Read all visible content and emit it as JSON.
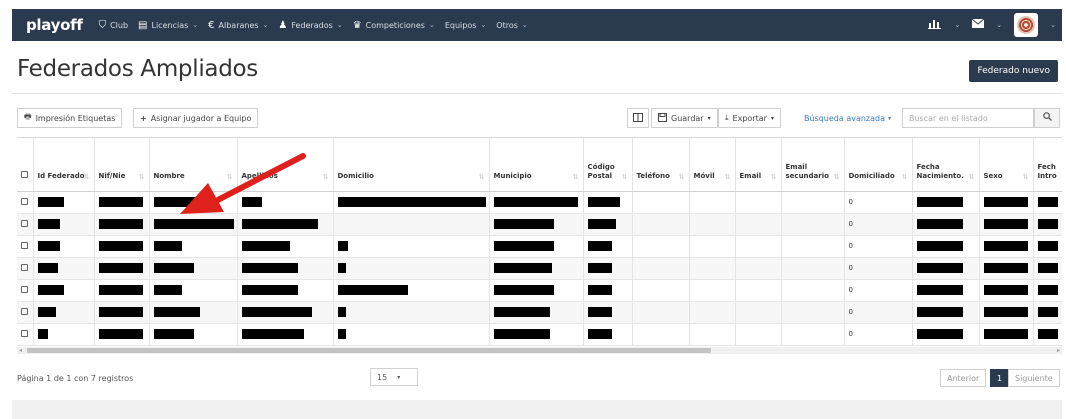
{
  "nav": {
    "brand": "playoff",
    "items": [
      {
        "icon": "shield-icon",
        "glyph": "⛉",
        "label": "Club",
        "caret": false
      },
      {
        "icon": "id-card-icon",
        "glyph": "▤",
        "label": "Licencias",
        "caret": true
      },
      {
        "icon": "euro-icon",
        "glyph": "€",
        "label": "Albaranes",
        "caret": true
      },
      {
        "icon": "user-icon",
        "glyph": "♟",
        "label": "Federados",
        "caret": true
      },
      {
        "icon": "trophy-icon",
        "glyph": "♛",
        "label": "Competiciones",
        "caret": true
      },
      {
        "icon": "",
        "glyph": "",
        "label": "Equipos",
        "caret": true
      },
      {
        "icon": "",
        "glyph": "",
        "label": "Otros",
        "caret": true
      }
    ],
    "right": {
      "chart_icon": "bar-chart-icon",
      "mail_icon": "envelope-icon",
      "avatar": "user-avatar"
    }
  },
  "page": {
    "title": "Federados Ampliados",
    "new_button": "Federado nuevo"
  },
  "toolbar": {
    "print_labels": "Impresión Etiquetas",
    "assign_player": "Asignar jugador a Equipo",
    "save": "Guardar",
    "export": "Exportar",
    "advanced_search": "Búsqueda avanzada",
    "search_placeholder": "Buscar en el listado"
  },
  "table": {
    "columns": [
      {
        "key": "id",
        "label": "Id Federado"
      },
      {
        "key": "nif",
        "label": "Nif/Nie"
      },
      {
        "key": "nombre",
        "label": "Nombre"
      },
      {
        "key": "apellidos",
        "label": "Apellidos"
      },
      {
        "key": "domicilio",
        "label": "Domicilio"
      },
      {
        "key": "municipio",
        "label": "Municipio"
      },
      {
        "key": "cp",
        "label": "Código Postal"
      },
      {
        "key": "telefono",
        "label": "Teléfono"
      },
      {
        "key": "movil",
        "label": "Móvil"
      },
      {
        "key": "email",
        "label": "Email"
      },
      {
        "key": "email2",
        "label": "Email secundario"
      },
      {
        "key": "domiciliado",
        "label": "Domiciliado"
      },
      {
        "key": "fecha",
        "label": "Fecha Nacimiento."
      },
      {
        "key": "sexo",
        "label": "Sexo"
      },
      {
        "key": "fecha_intro",
        "label": "Fech Intro"
      }
    ],
    "rows": [
      {
        "domiciliado": "0"
      },
      {
        "domiciliado": "0"
      },
      {
        "domiciliado": "0"
      },
      {
        "domiciliado": "0"
      },
      {
        "domiciliado": "0"
      },
      {
        "domiciliado": "0"
      },
      {
        "domiciliado": "0"
      }
    ]
  },
  "footer": {
    "info": "Página 1 de 1 con 7 registros",
    "page_size": "15",
    "prev": "Anterior",
    "current": "1",
    "next": "Siguiente"
  }
}
